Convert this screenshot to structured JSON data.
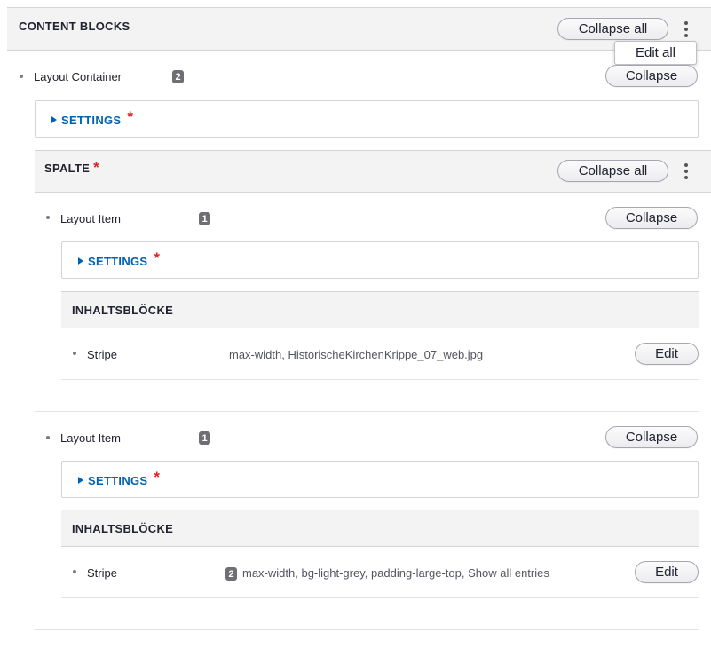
{
  "content_blocks": {
    "title": "CONTENT BLOCKS",
    "collapse_all_label": "Collapse all",
    "menu_icon": "kebab-vertical-icon",
    "edit_all_label": "Edit all"
  },
  "layout_container": {
    "label": "Layout Container",
    "count": "2",
    "collapse_label": "Collapse",
    "settings_label": "SETTINGS",
    "required_mark": "*",
    "spalte": {
      "title": "SPALTE",
      "required_mark": "*",
      "collapse_all_label": "Collapse all"
    }
  },
  "layout_items": [
    {
      "label": "Layout Item",
      "count": "1",
      "collapse_label": "Collapse",
      "settings_label": "SETTINGS",
      "required_mark": "*",
      "blocks_title": "INHALTSBLÖCKE",
      "stripe": {
        "label": "Stripe",
        "count": "",
        "summary": "max-width, HistorischeKirchenKrippe_07_web.jpg",
        "edit_label": "Edit"
      }
    },
    {
      "label": "Layout Item",
      "count": "1",
      "collapse_label": "Collapse",
      "settings_label": "SETTINGS",
      "required_mark": "*",
      "blocks_title": "INHALTSBLÖCKE",
      "stripe": {
        "label": "Stripe",
        "count": "2",
        "summary": "max-width, bg-light-grey, padding-large-top, Show all entries",
        "edit_label": "Edit"
      }
    }
  ],
  "colors": {
    "link_blue": "#0062b0",
    "required_red": "#dc2323",
    "header_bg": "#f3f3f4",
    "badge_bg": "#6e6e73"
  }
}
